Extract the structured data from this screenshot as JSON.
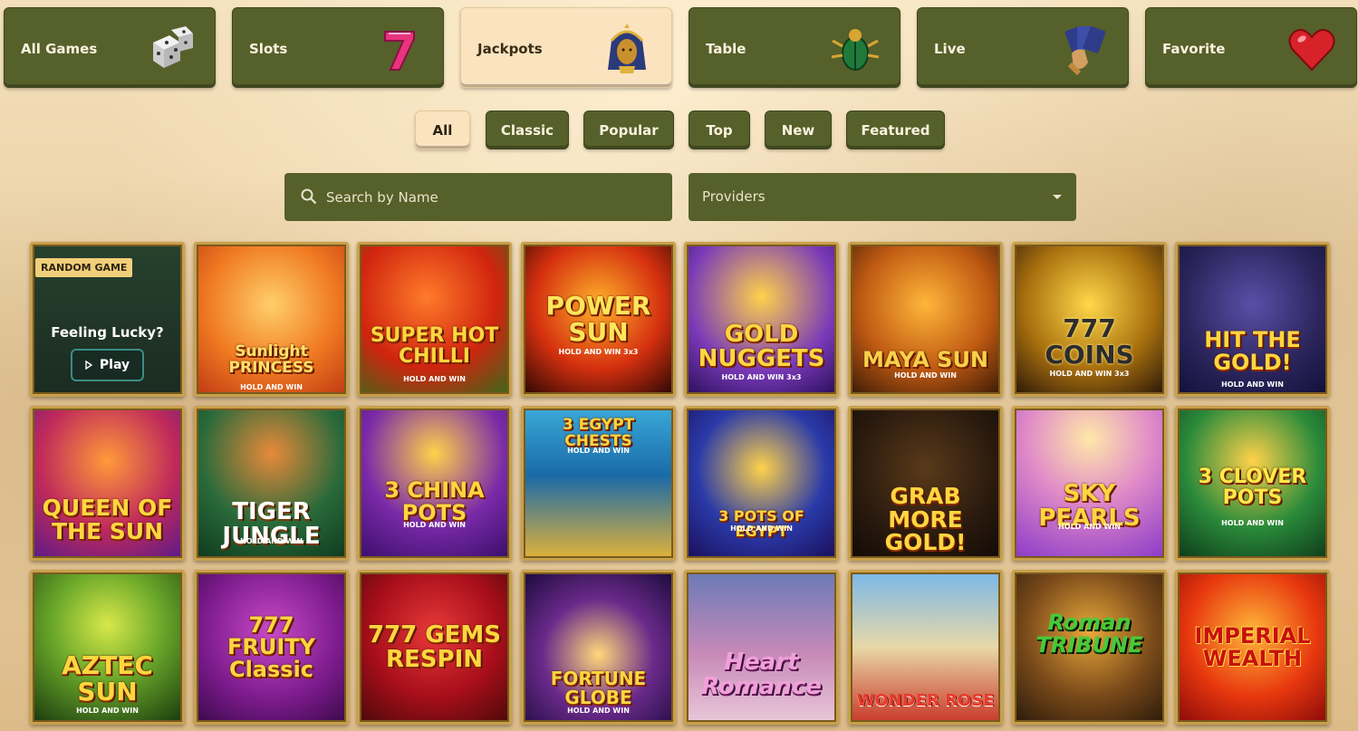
{
  "categories": [
    {
      "label": "All Games",
      "icon": "dice-icon",
      "active": false
    },
    {
      "label": "Slots",
      "icon": "seven-icon",
      "active": false
    },
    {
      "label": "Jackpots",
      "icon": "pharaoh-icon",
      "active": true
    },
    {
      "label": "Table",
      "icon": "scarab-icon",
      "active": false
    },
    {
      "label": "Live",
      "icon": "cards-hand-icon",
      "active": false
    },
    {
      "label": "Favorite",
      "icon": "heart-icon",
      "active": false
    }
  ],
  "filters": [
    {
      "label": "All",
      "active": true
    },
    {
      "label": "Classic",
      "active": false
    },
    {
      "label": "Popular",
      "active": false
    },
    {
      "label": "Top",
      "active": false
    },
    {
      "label": "New",
      "active": false
    },
    {
      "label": "Featured",
      "active": false
    }
  ],
  "search": {
    "placeholder": "Search by Name"
  },
  "providers": {
    "label": "Providers"
  },
  "random_game": {
    "badge": "RANDOM GAME",
    "text": "Feeling Lucky?",
    "play": "Play"
  },
  "games": [
    {
      "title": "Sunlight PRINCESS",
      "sub": "HOLD AND WIN"
    },
    {
      "title": "SUPER HOT CHILLI",
      "sub": "HOLD AND WIN"
    },
    {
      "title": "POWER SUN",
      "sub": "HOLD AND WIN 3x3"
    },
    {
      "title": "GOLD NUGGETS",
      "sub": "HOLD AND WIN 3x3"
    },
    {
      "title": "MAYA SUN",
      "sub": "HOLD AND WIN"
    },
    {
      "title": "777 COINS",
      "sub": "HOLD AND WIN 3x3"
    },
    {
      "title": "HIT THE GOLD!",
      "sub": "HOLD AND WIN"
    },
    {
      "title": "QUEEN OF THE SUN",
      "sub": ""
    },
    {
      "title": "TIGER JUNGLE",
      "sub": "HOLD AND WIN"
    },
    {
      "title": "3 CHINA POTS",
      "sub": "HOLD AND WIN"
    },
    {
      "title": "3 EGYPT CHESTS",
      "sub": "HOLD AND WIN"
    },
    {
      "title": "3 POTS OF EGYPT",
      "sub": "HOLD AND WIN"
    },
    {
      "title": "GRAB MORE GOLD!",
      "sub": ""
    },
    {
      "title": "SKY PEARLS",
      "sub": "HOLD AND WIN"
    },
    {
      "title": "3 CLOVER POTS",
      "sub": "HOLD AND WIN"
    },
    {
      "title": "AZTEC SUN",
      "sub": "HOLD AND WIN"
    },
    {
      "title": "777 FRUITY Classic",
      "sub": ""
    },
    {
      "title": "777 GEMS RESPIN",
      "sub": ""
    },
    {
      "title": "FORTUNE GLOBE",
      "sub": "HOLD AND WIN"
    },
    {
      "title": "Heart Romance",
      "sub": ""
    },
    {
      "title": "WONDER ROSE",
      "sub": ""
    },
    {
      "title": "Roman TRIBUNE",
      "sub": ""
    },
    {
      "title": "IMPERIAL WEALTH",
      "sub": ""
    }
  ]
}
